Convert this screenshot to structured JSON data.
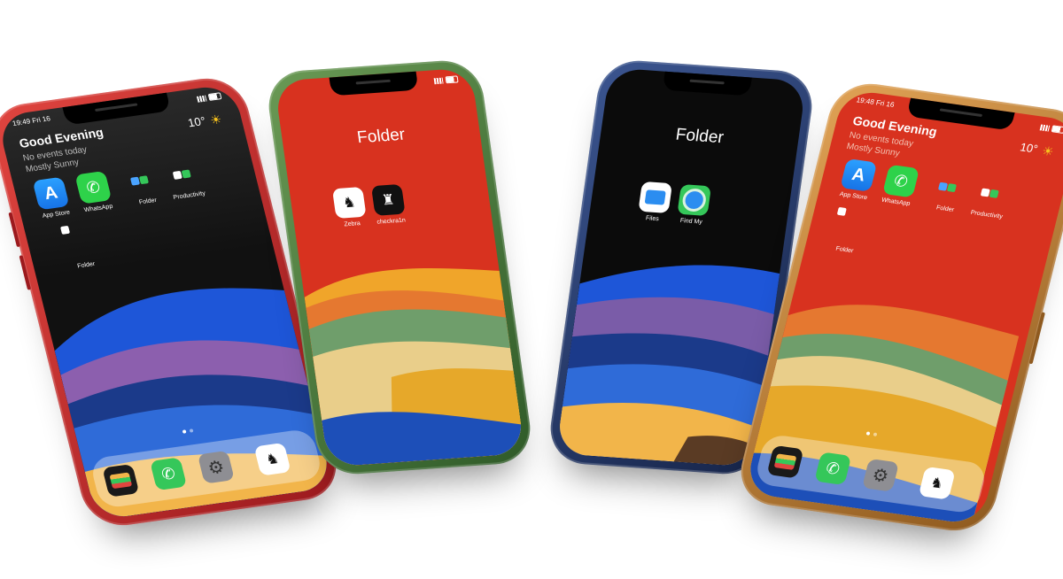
{
  "phones": {
    "red": {
      "status": {
        "time": "19:49",
        "day": "Fri 16"
      },
      "widget": {
        "greeting": "Good Evening",
        "events": "No events today",
        "weather": "Mostly Sunny",
        "temp": "10°"
      },
      "apps": [
        {
          "label": "App Store",
          "icon": "app-store-icon"
        },
        {
          "label": "WhatsApp",
          "icon": "whatsapp-icon"
        },
        {
          "label": "Folder",
          "icon": "folder-icon"
        },
        {
          "label": "Productivity",
          "icon": "folder-icon"
        }
      ],
      "extra_folder": "Folder",
      "dock": [
        "Wallet",
        "Phone",
        "Settings",
        "Zebra"
      ]
    },
    "green": {
      "folder_title": "Folder",
      "apps": [
        {
          "label": "Zebra",
          "icon": "zebra-icon"
        },
        {
          "label": "checkra1n",
          "icon": "checkra1n-icon"
        }
      ]
    },
    "blue": {
      "folder_title": "Folder",
      "apps": [
        {
          "label": "Files",
          "icon": "files-icon"
        },
        {
          "label": "Find My",
          "icon": "find-my-icon"
        }
      ]
    },
    "gold": {
      "status": {
        "time": "19:48",
        "day": "Fri 16"
      },
      "widget": {
        "greeting": "Good Evening",
        "events": "No events today",
        "weather": "Mostly Sunny",
        "temp": "10°"
      },
      "apps": [
        {
          "label": "App Store",
          "icon": "app-store-icon"
        },
        {
          "label": "WhatsApp",
          "icon": "whatsapp-icon"
        },
        {
          "label": "Folder",
          "icon": "folder-icon"
        },
        {
          "label": "Productivity",
          "icon": "folder-icon"
        }
      ],
      "extra_folder": "Folder",
      "dock": [
        "Wallet",
        "Phone",
        "Settings",
        "Zebra"
      ]
    }
  },
  "colors": {
    "red_frame": "#c0262a",
    "green_frame": "#4a7a3a",
    "blue_frame": "#22345e",
    "gold_frame": "#c2853a",
    "wallpaper_red": "#d8321f",
    "wallpaper_dark": "#111111"
  }
}
